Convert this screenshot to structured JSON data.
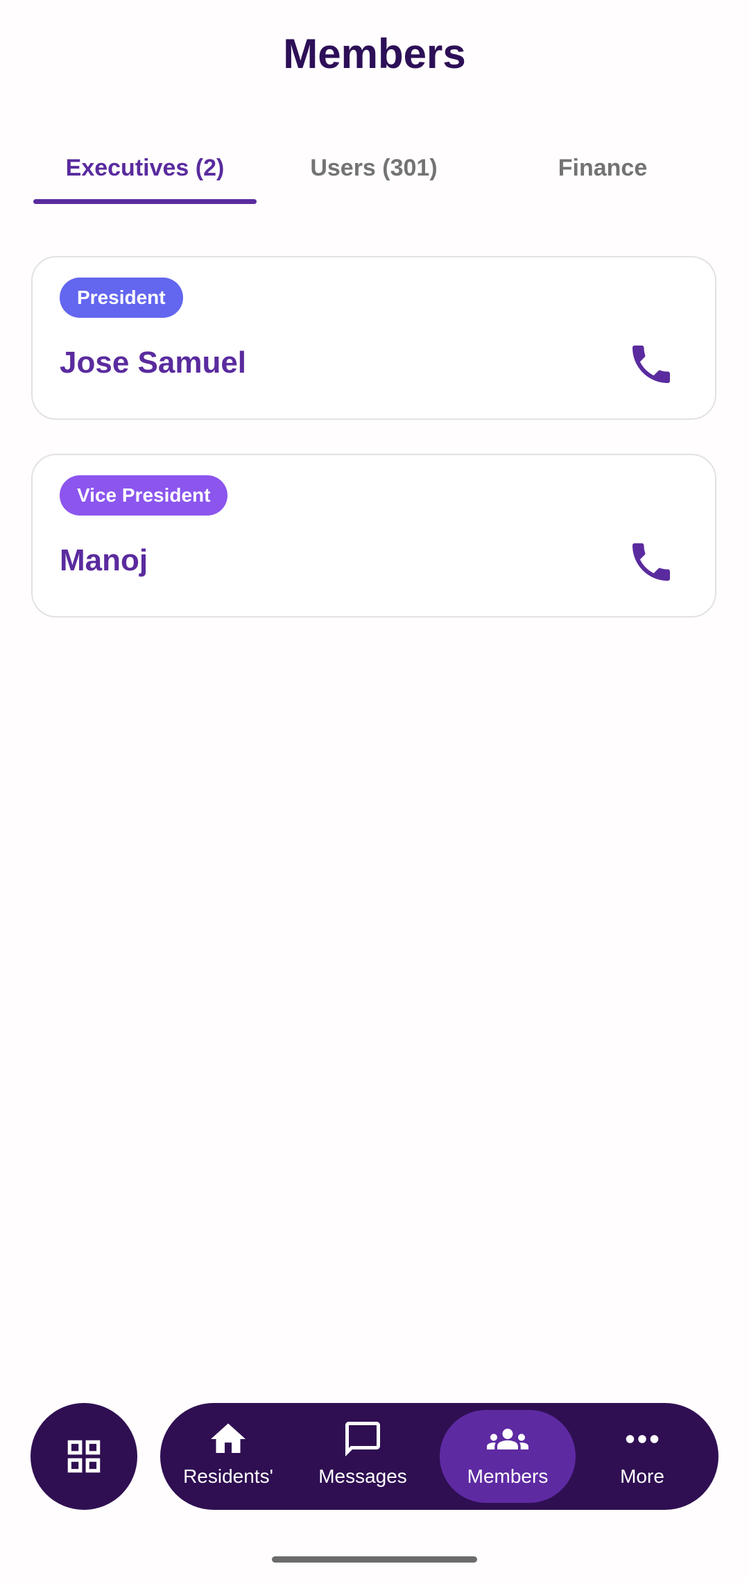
{
  "header": {
    "title": "Members"
  },
  "tabs": [
    {
      "label": "Executives (2)",
      "active": true
    },
    {
      "label": "Users (301)",
      "active": false
    },
    {
      "label": "Finance",
      "active": false
    }
  ],
  "executives": [
    {
      "role": "President",
      "name": "Jose Samuel",
      "badge_color": "#6366ee",
      "action_icon": "phone-icon"
    },
    {
      "role": "Vice President",
      "name": "Manoj",
      "badge_color": "#8b55ee",
      "action_icon": "phone-icon"
    }
  ],
  "bottom_nav": {
    "fab_icon": "grid-icon",
    "items": [
      {
        "label": "Residents'",
        "icon": "home-icon",
        "active": false
      },
      {
        "label": "Messages",
        "icon": "chat-bubble-icon",
        "active": false
      },
      {
        "label": "Members",
        "icon": "people-group-icon",
        "active": true
      },
      {
        "label": "More",
        "icon": "more-dots-icon",
        "active": false
      }
    ]
  },
  "colors": {
    "primary_dark": "#2f0f52",
    "primary": "#5a2b9e",
    "active_nav": "#5e2aa2",
    "inactive_tab": "#737373"
  }
}
